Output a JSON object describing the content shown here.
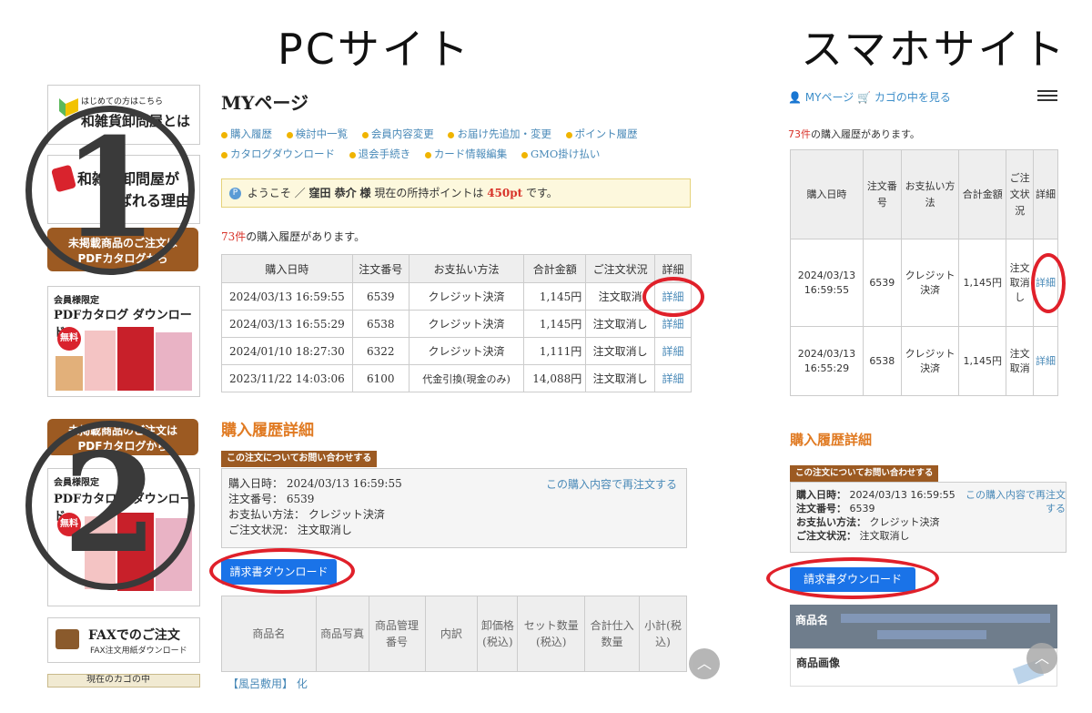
{
  "headings": {
    "pc": "PCサイト",
    "sp": "スマホサイト"
  },
  "step_numbers": [
    "1",
    "2"
  ],
  "sidebar": {
    "banner1_small": "はじめての方はこちら",
    "banner1_main": "和雑貨卸問屋とは",
    "banner2_line1": "和雑貨卸問屋が",
    "banner2_line2": "選ばれる理由",
    "brown_line1": "未掲載商品のご注文は",
    "brown_line2": "PDFカタログから",
    "pdf_small": "会員様限定",
    "pdf_main": "PDFカタログ ダウンロード",
    "free_badge": "無料",
    "fax_main": "FAXでのご注文",
    "fax_sub": "FAX注文用紙ダウンロード",
    "cart_label": "現在のカゴの中"
  },
  "pc": {
    "page_title": "MYページ",
    "nav_row1": [
      "購入履歴",
      "検討中一覧",
      "会員内容変更",
      "お届け先追加・変更",
      "ポイント履歴"
    ],
    "nav_row2": [
      "カタログダウンロード",
      "退会手続き",
      "カード情報編集",
      "GMO掛け払い"
    ],
    "welcome": {
      "icon": "P",
      "prefix": "ようこそ ／",
      "name": "窪田 恭介",
      "honorific": "様",
      "points_text": "現在の所持ポイントは",
      "points": "450pt",
      "suffix": "です。"
    },
    "history_count": "73件",
    "history_count_suffix": "の購入履歴があります。",
    "table_headers": [
      "購入日時",
      "注文番号",
      "お支払い方法",
      "合計金額",
      "ご注文状況",
      "詳細"
    ],
    "rows": [
      {
        "date": "2024/03/13 16:59:55",
        "no": "6539",
        "method": "クレジット決済",
        "amount": "1,145円",
        "status": "注文取消",
        "detail": "詳細"
      },
      {
        "date": "2024/03/13 16:55:29",
        "no": "6538",
        "method": "クレジット決済",
        "amount": "1,145円",
        "status": "注文取消し",
        "detail": "詳細"
      },
      {
        "date": "2024/01/10 18:27:30",
        "no": "6322",
        "method": "クレジット決済",
        "amount": "1,111円",
        "status": "注文取消し",
        "detail": "詳細"
      },
      {
        "date": "2023/11/22 14:03:06",
        "no": "6100",
        "method": "代金引換(現金のみ)",
        "amount": "14,088円",
        "status": "注文取消し",
        "detail": "詳細"
      }
    ],
    "detail_title": "購入履歴詳細",
    "inquiry_tag": "この注文についてお問い合わせする",
    "detail": {
      "date_label": "購入日時：",
      "date": "2024/03/13 16:59:55",
      "no_label": "注文番号：",
      "no": "6539",
      "method_label": "お支払い方法：",
      "method": "クレジット決済",
      "status_label": "ご注文状況：",
      "status": "注文取消し",
      "reorder": "この購入内容で再注文する"
    },
    "download_button": "請求書ダウンロード",
    "item_headers": [
      "商品名",
      "商品写真",
      "商品管理番号",
      "内訳",
      "卸価格(税込)",
      "セット数量(税込)",
      "合計仕入数量",
      "小計(税込)"
    ],
    "item_first": "【風呂敷用】 化"
  },
  "sp": {
    "my_page": "MYページ",
    "cart": "カゴの中を見る",
    "history_count": "73件",
    "history_count_suffix": "の購入履歴があります。",
    "table_headers": [
      "購入日時",
      "注文番号",
      "お支払い方法",
      "合計金額",
      "ご注文状況",
      "詳細"
    ],
    "rows": [
      {
        "date": "2024/03/13 16:59:55",
        "no": "6539",
        "method": "クレジット決済",
        "amount": "1,145円",
        "status": "注文取消し",
        "detail": "詳細"
      },
      {
        "date": "2024/03/13 16:55:29",
        "no": "6538",
        "method": "クレジット決済",
        "amount": "1,145円",
        "status": "注文取消",
        "detail": "詳細"
      }
    ],
    "detail_title": "購入履歴詳細",
    "inquiry_tag": "この注文についてお問い合わせする",
    "detail": {
      "date_label": "購入日時：",
      "date": "2024/03/13 16:59:55",
      "no_label": "注文番号：",
      "no": "6539",
      "method_label": "お支払い方法：",
      "method": "クレジット決済",
      "status_label": "ご注文状況：",
      "status": "注文取消し",
      "reorder": "この購入内容で再注文する"
    },
    "download_button": "請求書ダウンロード",
    "item_label": "商品名",
    "image_label": "商品画像"
  },
  "colors": {
    "highlight": "#e0202a",
    "button": "#1a73e8",
    "link": "#4a8ab8",
    "accent_orange": "#e07a22",
    "brown": "#9c5a22"
  }
}
